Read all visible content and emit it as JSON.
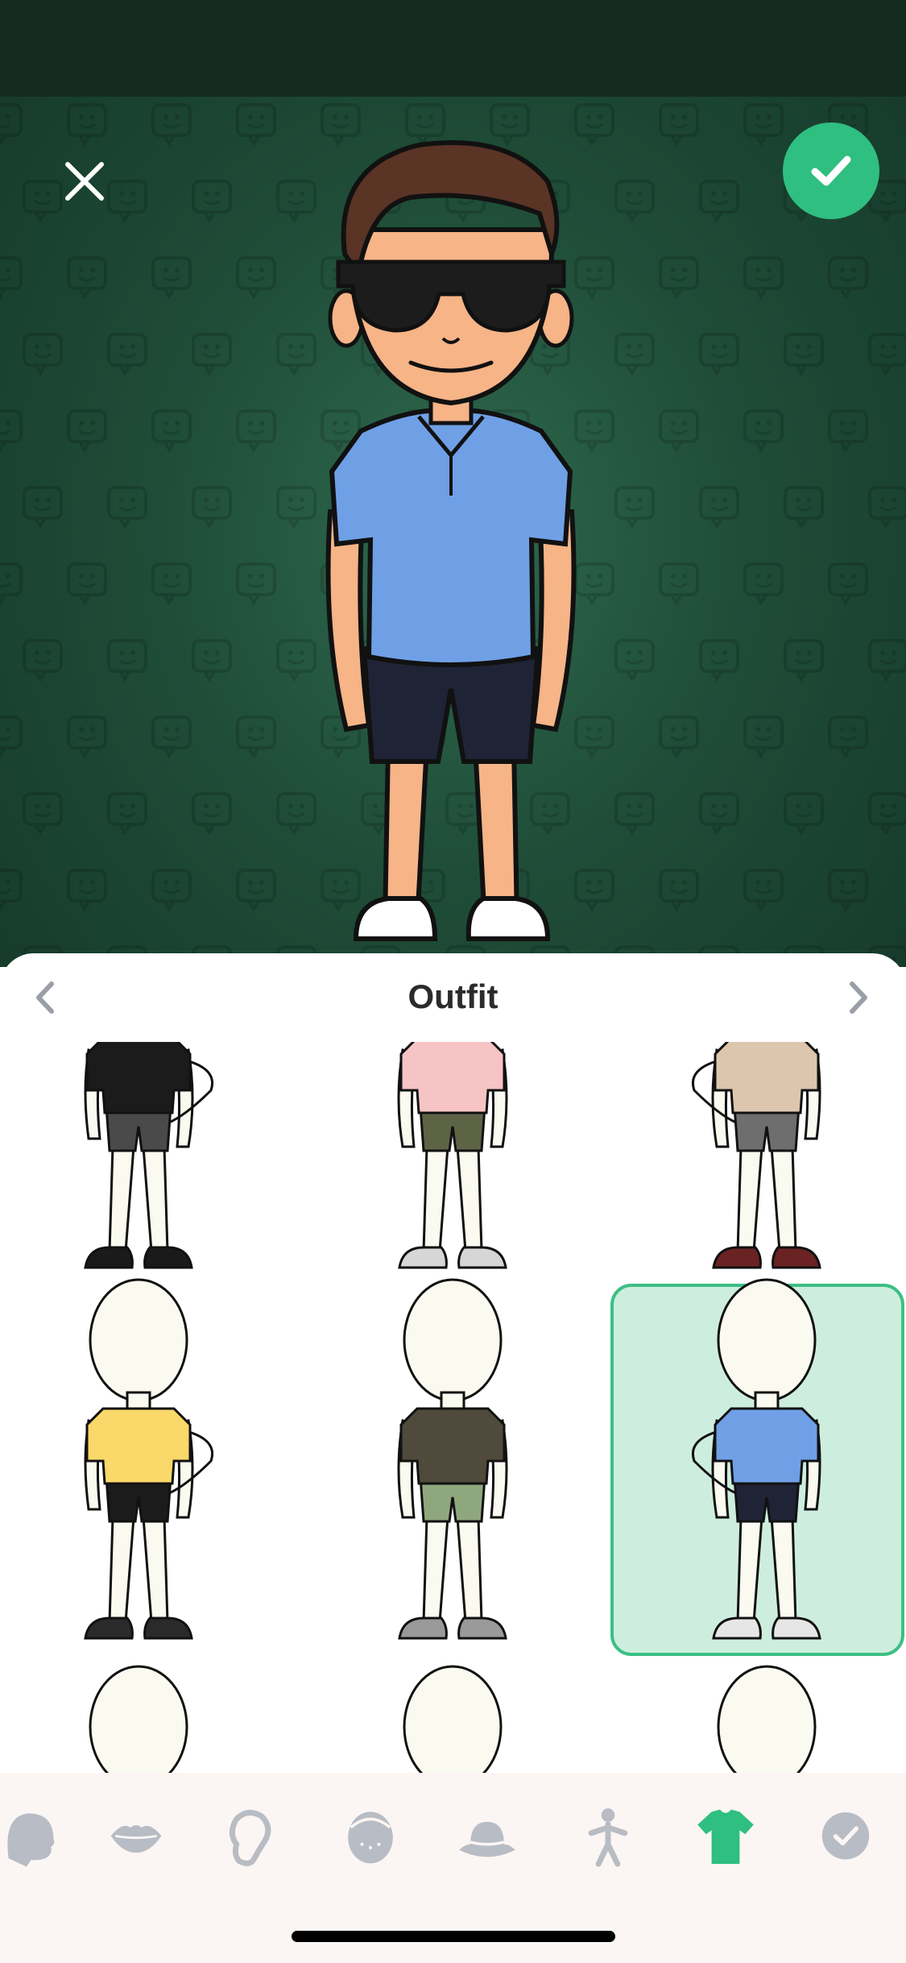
{
  "preview": {
    "close_icon": "close-icon",
    "confirm_icon": "checkmark-icon",
    "avatar": {
      "description_icon": "bitmoji-avatar",
      "shirt_color": "#6fa0e6",
      "shorts_color": "#1f2336",
      "hair_color": "#5a3425",
      "skin_color": "#f6b487"
    },
    "accent_color": "#2fbf80"
  },
  "sheet": {
    "title": "Outfit",
    "prev_icon": "chevron-left-icon",
    "next_icon": "chevron-right-icon",
    "outfits": [
      {
        "shirt": "#1b1b1b",
        "shorts": "#4a4a4a",
        "shoes": "#1a1a1a",
        "pose": "left",
        "selected": false
      },
      {
        "shirt": "#f6c4c4",
        "shorts": "#5d6446",
        "shoes": "#d6d6d6",
        "pose": "front",
        "selected": false
      },
      {
        "shirt": "#dcc6ad",
        "shorts": "#6e6e6e",
        "shoes": "#6b2222",
        "pose": "right",
        "selected": false
      },
      {
        "shirt": "#fad86a",
        "shorts": "#1b1b1b",
        "shoes": "#2a2a2a",
        "pose": "left",
        "selected": false
      },
      {
        "shirt": "#4f4a3b",
        "shorts": "#8fa77d",
        "shoes": "#9a9a9a",
        "pose": "front",
        "selected": false
      },
      {
        "shirt": "#6fa0e6",
        "shorts": "#1f2336",
        "shoes": "#e6e6e6",
        "pose": "right",
        "selected": true
      },
      {
        "shirt": "#ffffff",
        "shorts": "#ffffff",
        "shoes": "#ffffff",
        "pose": "left",
        "selected": false
      },
      {
        "shirt": "#ffffff",
        "shorts": "#ffffff",
        "shoes": "#ffffff",
        "pose": "front",
        "selected": false
      },
      {
        "shirt": "#ffffff",
        "shorts": "#ffffff",
        "shoes": "#ffffff",
        "pose": "right",
        "selected": false
      }
    ]
  },
  "tabs": [
    {
      "icon": "head-shape-icon",
      "active": false
    },
    {
      "icon": "lips-icon",
      "active": false
    },
    {
      "icon": "ear-icon",
      "active": false
    },
    {
      "icon": "face-details-icon",
      "active": false
    },
    {
      "icon": "hat-icon",
      "active": false
    },
    {
      "icon": "body-icon",
      "active": false
    },
    {
      "icon": "tshirt-icon",
      "active": true
    },
    {
      "icon": "checkmark-circle-icon",
      "active": false
    }
  ],
  "colors": {
    "tab_inactive": "#b8bcc4",
    "tab_active": "#2fbf80"
  }
}
